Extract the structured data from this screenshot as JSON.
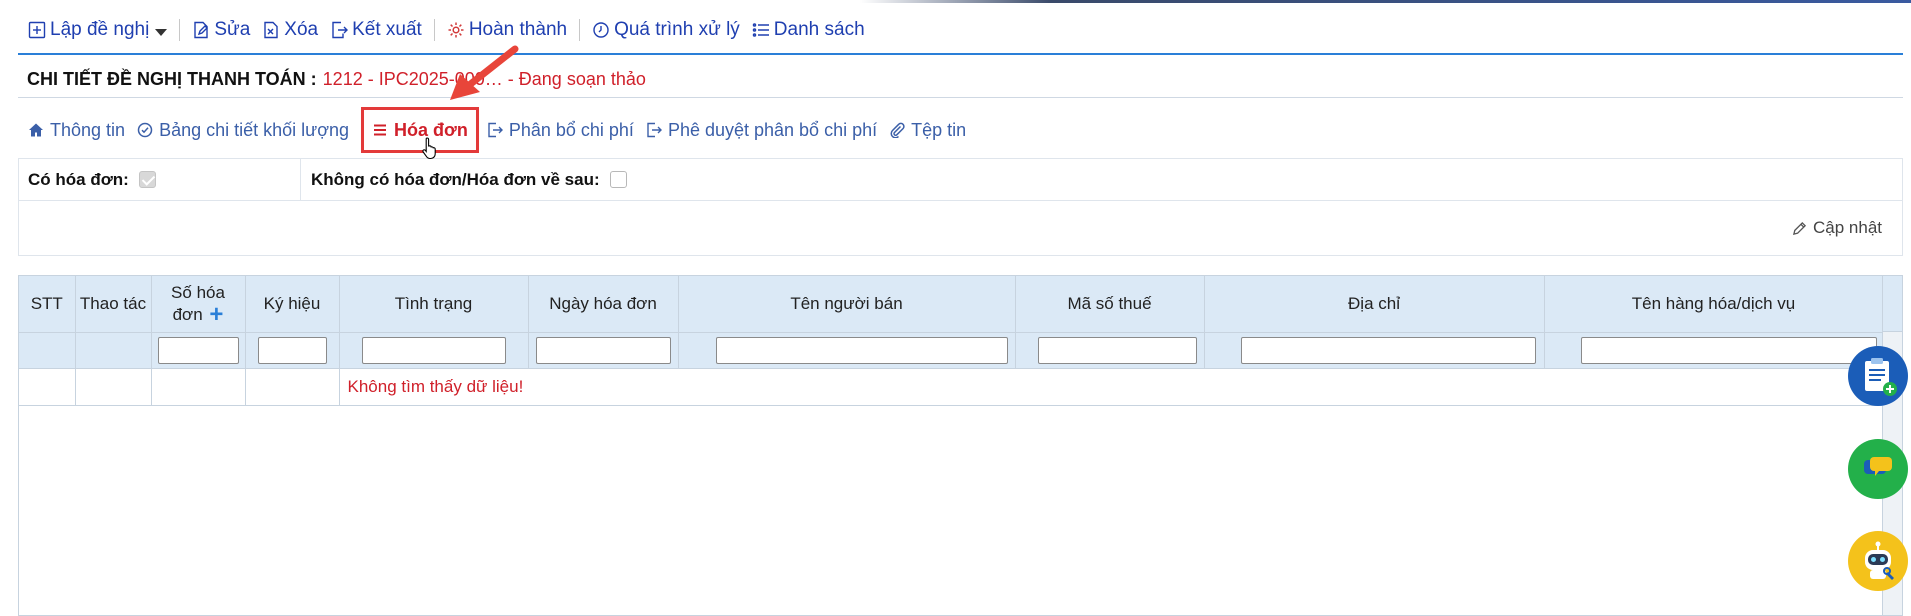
{
  "toolbar": {
    "create_label": "Lập đề nghị",
    "edit_label": "Sửa",
    "delete_label": "Xóa",
    "export_label": "Kết xuất",
    "complete_label": "Hoàn thành",
    "process_label": "Quá trình xử lý",
    "list_label": "Danh sách"
  },
  "header": {
    "title_label": "CHI TIẾT ĐỀ NGHỊ THANH TOÁN :",
    "title_value": "1212 - IPC2025-000… - Đang soạn thảo"
  },
  "tabs": [
    {
      "label": "Thông tin"
    },
    {
      "label": "Bảng chi tiết khối lượng"
    },
    {
      "label": "Hóa đơn"
    },
    {
      "label": "Phân bổ chi phí"
    },
    {
      "label": "Phê duyệt phân bổ chi phí"
    },
    {
      "label": "Tệp tin"
    }
  ],
  "invoice_flags": {
    "has_invoice_label": "Có hóa đơn:",
    "has_invoice_checked": true,
    "no_invoice_label": "Không có hóa đơn/Hóa đơn về sau:",
    "no_invoice_checked": false
  },
  "update_label": "Cập nhật",
  "grid": {
    "columns": [
      {
        "label": "STT"
      },
      {
        "label": "Thao tác"
      },
      {
        "label": "Số hóa đơn"
      },
      {
        "label": "Ký hiệu"
      },
      {
        "label": "Tình trạng"
      },
      {
        "label": "Ngày hóa đơn"
      },
      {
        "label": "Tên người bán"
      },
      {
        "label": "Mã số thuế"
      },
      {
        "label": "Địa chỉ"
      },
      {
        "label": "Tên hàng hóa/dịch vụ"
      }
    ],
    "add_symbol": "+",
    "no_data_message": "Không tìm thấy dữ liệu!"
  },
  "colors": {
    "accent_blue": "#1f3fb0",
    "title_red": "#d0202a",
    "header_bg": "#dbe9f6"
  }
}
